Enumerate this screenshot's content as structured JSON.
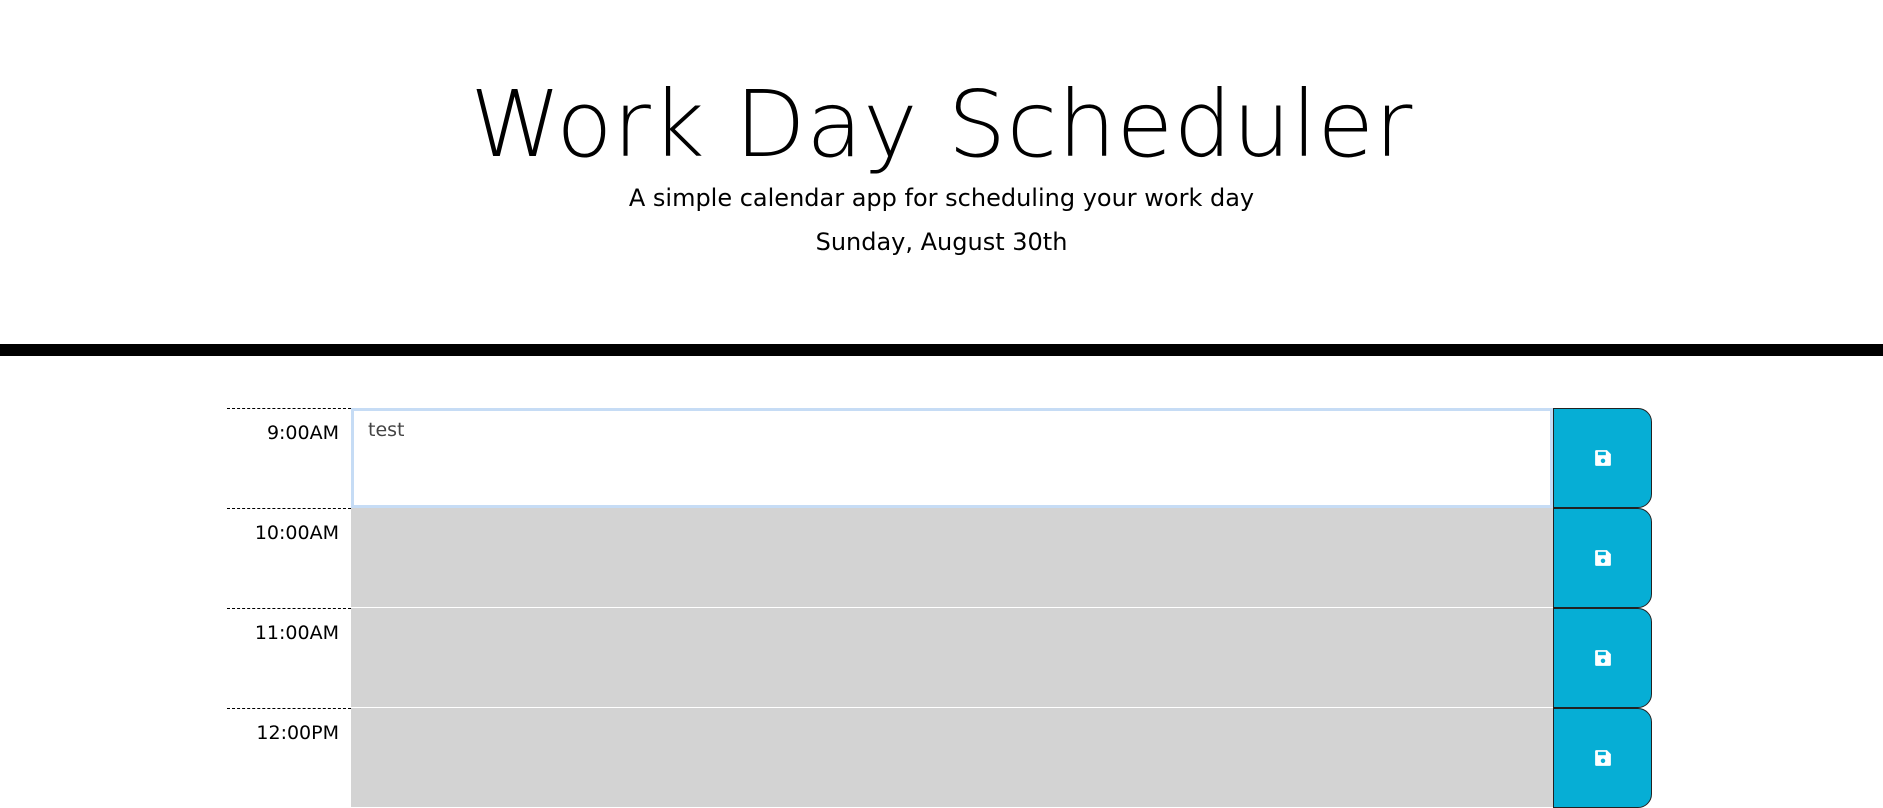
{
  "header": {
    "title": "Work Day Scheduler",
    "subtitle": "A simple calendar app for scheduling your work day",
    "current_day": "Sunday, August 30th"
  },
  "time_blocks": [
    {
      "hour": "9:00AM",
      "text": "test",
      "state": "present"
    },
    {
      "hour": "10:00AM",
      "text": "",
      "state": "past"
    },
    {
      "hour": "11:00AM",
      "text": "",
      "state": "past"
    },
    {
      "hour": "12:00PM",
      "text": "",
      "state": "past"
    }
  ],
  "icons": {
    "save": "floppy-disk-icon"
  },
  "colors": {
    "save_button": "#06aed5",
    "past_block": "#d3d3d3",
    "present_block": "#ffffff",
    "header_border": "#000000"
  }
}
